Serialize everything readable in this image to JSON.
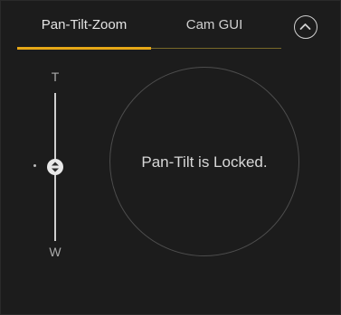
{
  "tabs": [
    {
      "label": "Pan-Tilt-Zoom",
      "active": true
    },
    {
      "label": "Cam GUI",
      "active": false
    }
  ],
  "zoom": {
    "tele_label": "T",
    "wide_label": "W",
    "level": 0.5
  },
  "pan_tilt": {
    "status_text": "Pan-Tilt is Locked."
  },
  "colors": {
    "accent": "#e6a817",
    "background": "#1c1c1c"
  },
  "icons": {
    "collapse": "chevron-up-circle-icon",
    "zoom_thumb": "up-down-arrows-icon"
  }
}
